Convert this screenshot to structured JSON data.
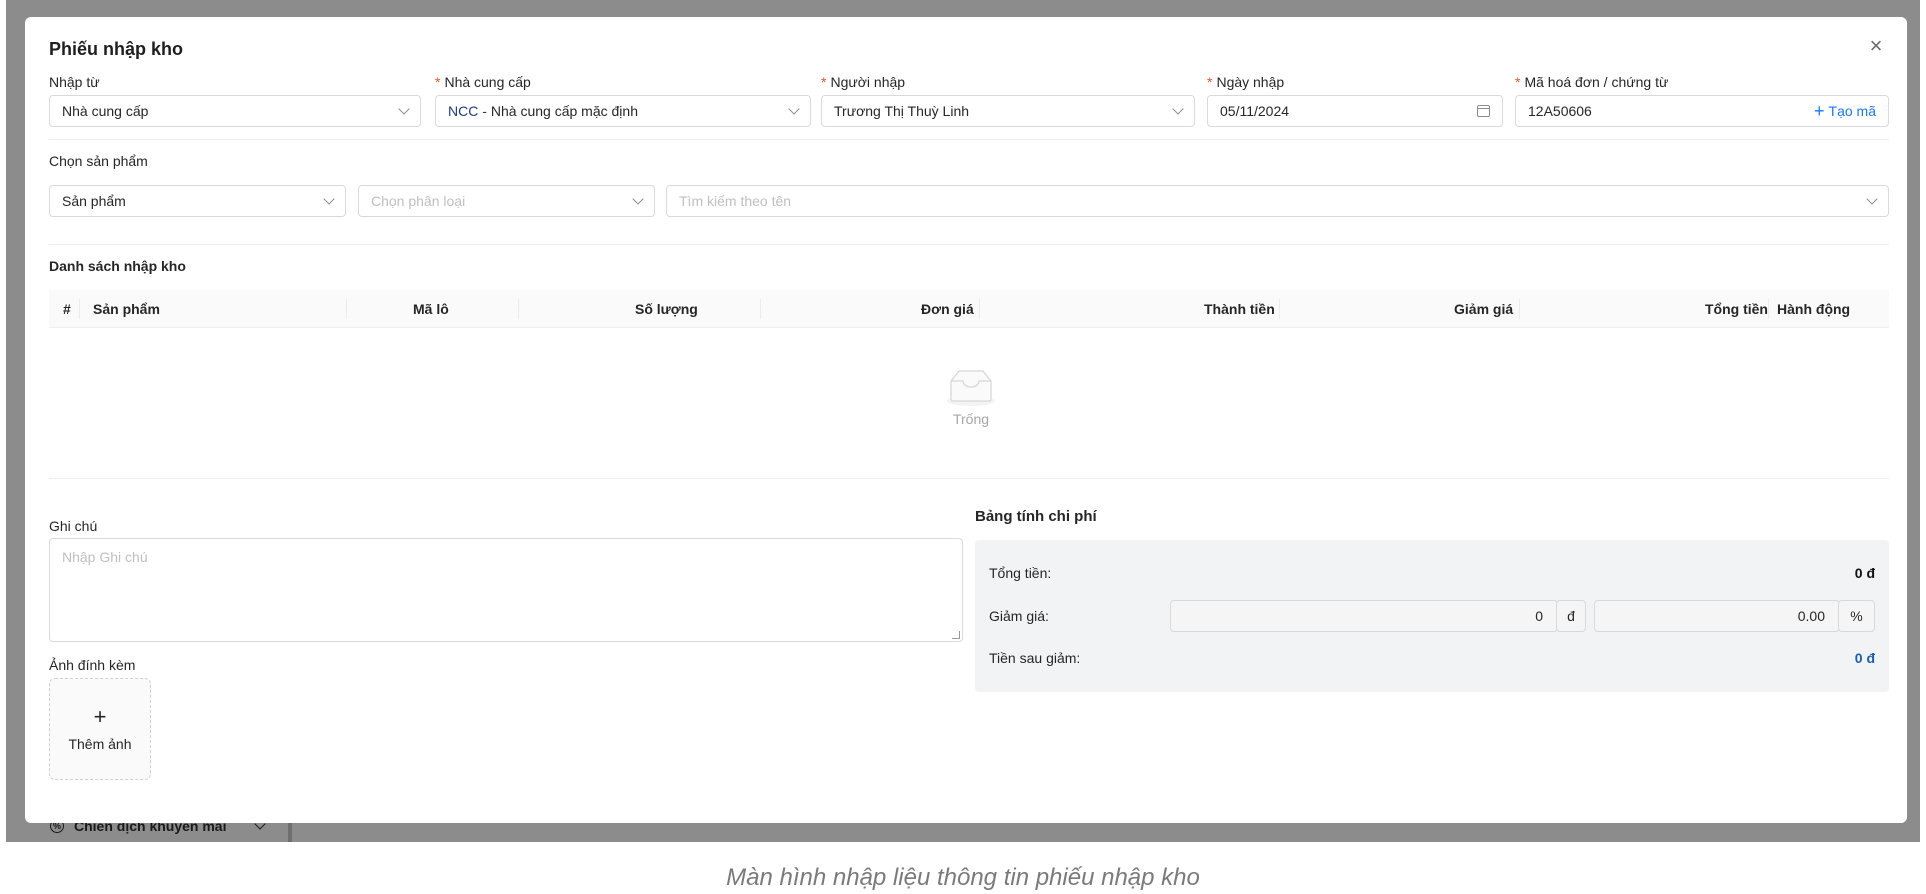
{
  "background": {
    "sidebar_item_label": "Chiến dịch khuyến mãi"
  },
  "modal": {
    "title": "Phiếu nhập kho",
    "close_glyph": "×"
  },
  "form": {
    "import_from": {
      "label": "Nhập từ",
      "value": "Nhà cung cấp"
    },
    "supplier": {
      "label": "Nhà cung cấp",
      "required_mark": "*",
      "code": "NCC -",
      "value": "Nhà cung cấp mặc định"
    },
    "importer": {
      "label": "Người nhập",
      "required_mark": "*",
      "value": "Trương Thị Thuỳ Linh"
    },
    "import_date": {
      "label": "Ngày nhập",
      "required_mark": "*",
      "value": "05/11/2024"
    },
    "invoice_code": {
      "label": "Mã hoá đơn / chứng từ",
      "required_mark": "*",
      "value": "12A50606",
      "generate_label": "Tạo mã"
    }
  },
  "product_picker": {
    "section_label": "Chọn sản phẩm",
    "type_value": "Sản phẩm",
    "category_placeholder": "Chọn phân loại",
    "search_placeholder": "Tìm kiếm theo tên"
  },
  "import_list": {
    "title": "Danh sách nhập kho",
    "columns": [
      "#",
      "Sản phẩm",
      "Mã lô",
      "Số lượng",
      "Đơn giá",
      "Thành tiền",
      "Giảm giá",
      "Tổng tiền",
      "Hành động"
    ],
    "empty_text": "Trống"
  },
  "notes": {
    "label": "Ghi chú",
    "placeholder": "Nhập Ghi chú"
  },
  "attachments": {
    "label": "Ảnh đính kèm",
    "add_label": "Thêm ảnh"
  },
  "cost_table": {
    "title": "Bảng tính chi phí",
    "total_label": "Tổng tiền:",
    "total_value": "0 đ",
    "discount_label": "Giảm giá:",
    "discount_amount": "0",
    "discount_amount_unit": "đ",
    "discount_percent": "0.00",
    "discount_percent_unit": "%",
    "after_discount_label": "Tiền sau giảm:",
    "after_discount_value": "0 đ"
  },
  "caption": "Màn hình nhập liệu thông tin phiếu nhập kho",
  "colors": {
    "accent": "#1677ff",
    "required": "#e4571f",
    "total_after": "#1a5fb4"
  }
}
